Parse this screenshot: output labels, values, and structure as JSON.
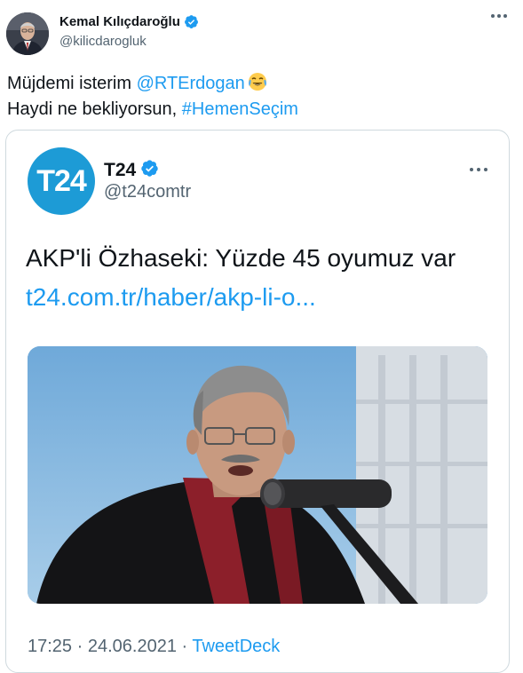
{
  "author": {
    "name": "Kemal Kılıçdaroğlu",
    "handle": "@kilicdarogluk"
  },
  "tweet": {
    "line1_text": "Müjdemi isterim ",
    "line1_mention": "@RTErdogan",
    "line2_text": "Haydi ne bekliyorsun, ",
    "line2_hashtag": "#HemenSeçim"
  },
  "quoted": {
    "logo_text": "T24",
    "name": "T24",
    "handle": "@t24comtr",
    "title": "AKP'li Özhaseki: Yüzde 45 oyumuz var",
    "link": "t24.com.tr/haber/akp-li-o...",
    "time": "17:25",
    "separator1": " · ",
    "date": "24.06.2021",
    "separator2": " · ",
    "source": "TweetDeck"
  },
  "colors": {
    "link": "#1d9bf0",
    "verified": "#1d9bf0",
    "t24_brand": "#1d9bd6",
    "secondary_text": "#536471"
  },
  "icons": {
    "verified": "verified-badge-icon",
    "more": "more-dots-icon",
    "emoji": "face-with-tears-of-joy-emoji"
  }
}
